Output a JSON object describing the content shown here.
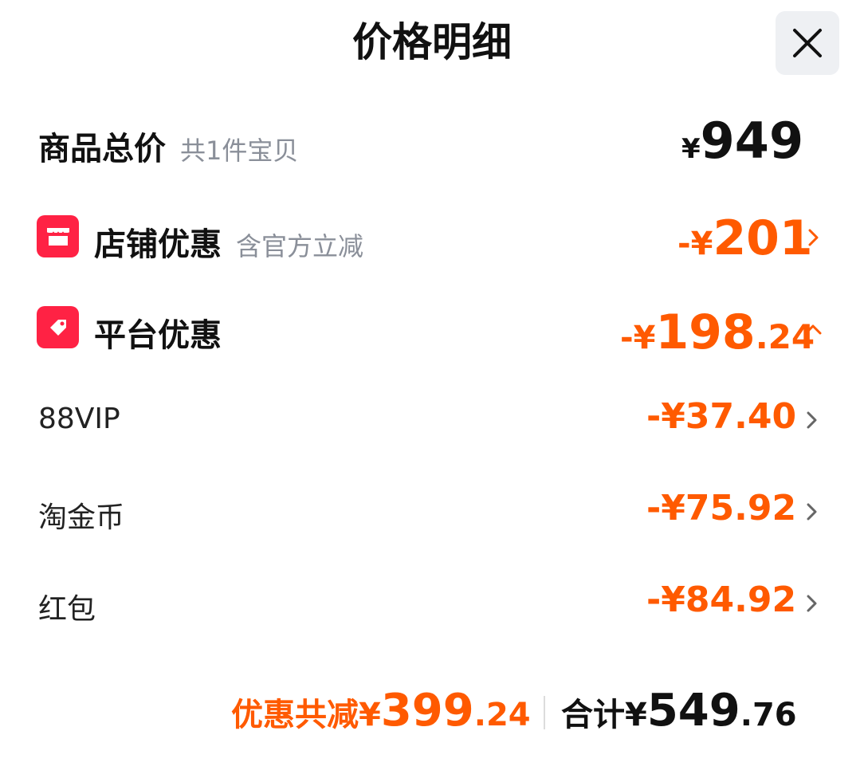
{
  "header": {
    "title": "价格明细",
    "close_icon": "close-icon"
  },
  "colors": {
    "accent": "#ff5a00",
    "badge": "#ff2244",
    "text": "#111111",
    "muted": "#8a8f99"
  },
  "goods_total": {
    "label": "商品总价",
    "sub": "共1件宝贝",
    "currency": "¥",
    "amount": "949"
  },
  "store_discount": {
    "label": "店铺优惠",
    "sub": "含官方立减",
    "prefix": "-¥",
    "amount": "201",
    "icon": "store-icon"
  },
  "platform_discount": {
    "label": "平台优惠",
    "prefix": "-¥",
    "int": "198",
    "dec": ".24",
    "icon": "coupon-tag-icon",
    "expanded": true
  },
  "platform_items": [
    {
      "label": "88VIP",
      "amount": "-¥37.40"
    },
    {
      "label": "淘金币",
      "amount": "-¥75.92"
    },
    {
      "label": "红包",
      "amount": "-¥84.92"
    }
  ],
  "footer": {
    "discount_label": "优惠共减¥",
    "discount_int": "399",
    "discount_dec": ".24",
    "total_label": "合计¥",
    "total_int": "549",
    "total_dec": ".76"
  }
}
